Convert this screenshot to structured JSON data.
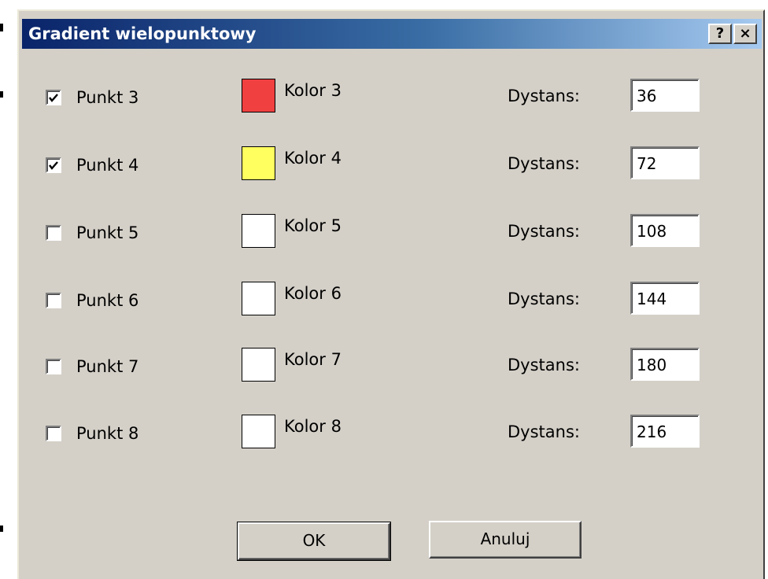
{
  "window": {
    "title": "Gradient wielopunktowy",
    "help_button": "?",
    "close_button": "×"
  },
  "rows": [
    {
      "point_label": "Punkt 3",
      "checked": true,
      "color_label": "Kolor 3",
      "color": "#f04040",
      "distance_label": "Dystans:",
      "distance": "36"
    },
    {
      "point_label": "Punkt 4",
      "checked": true,
      "color_label": "Kolor 4",
      "color": "#ffff60",
      "distance_label": "Dystans:",
      "distance": "72"
    },
    {
      "point_label": "Punkt 5",
      "checked": false,
      "color_label": "Kolor 5",
      "color": "#ffffff",
      "distance_label": "Dystans:",
      "distance": "108"
    },
    {
      "point_label": "Punkt 6",
      "checked": false,
      "color_label": "Kolor 6",
      "color": "#ffffff",
      "distance_label": "Dystans:",
      "distance": "144"
    },
    {
      "point_label": "Punkt 7",
      "checked": false,
      "color_label": "Kolor 7",
      "color": "#ffffff",
      "distance_label": "Dystans:",
      "distance": "180"
    },
    {
      "point_label": "Punkt 8",
      "checked": false,
      "color_label": "Kolor 8",
      "color": "#ffffff",
      "distance_label": "Dystans:",
      "distance": "216"
    }
  ],
  "buttons": {
    "ok": "OK",
    "cancel": "Anuluj"
  },
  "colors": {
    "dialog_face": "#d4d0c8",
    "titlebar_start": "#0a246a",
    "titlebar_end": "#a6caf0"
  }
}
